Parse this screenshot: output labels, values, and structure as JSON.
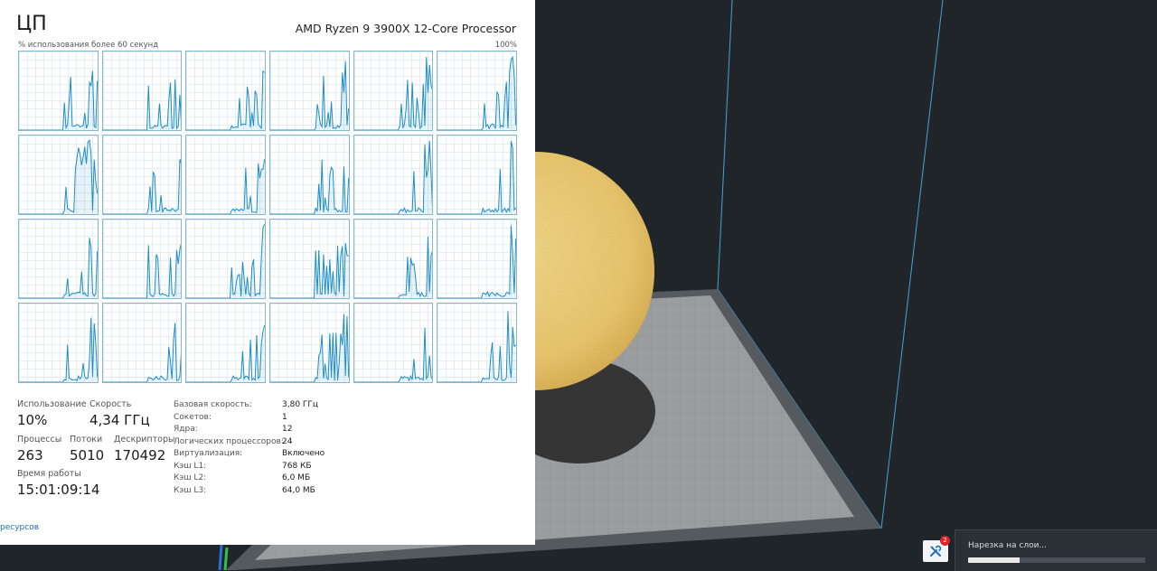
{
  "task_manager": {
    "title": "ЦП",
    "cpu_name": "AMD Ryzen 9 3900X 12-Core Processor",
    "graph_subtitle": "% использования более 60 секунд",
    "graph_max": "100%",
    "logical_processor_count": 24,
    "stats": {
      "usage_label": "Использование",
      "usage_value": "10%",
      "speed_label": "Скорость",
      "speed_value": "4,34 ГГц",
      "processes_label": "Процессы",
      "processes_value": "263",
      "threads_label": "Потоки",
      "threads_value": "5010",
      "handles_label": "Дескрипторы",
      "handles_value": "170492",
      "uptime_label": "Время работы",
      "uptime_value": "15:01:09:14"
    },
    "specs": [
      {
        "label": "Базовая скорость:",
        "value": "3,80 ГГц"
      },
      {
        "label": "Сокетов:",
        "value": "1"
      },
      {
        "label": "Ядра:",
        "value": "12"
      },
      {
        "label": "Логических процессоров:",
        "value": "24"
      },
      {
        "label": "Виртуализация:",
        "value": "Включено"
      },
      {
        "label": "Кэш L1:",
        "value": "768 КБ"
      },
      {
        "label": "Кэш L2:",
        "value": "6,0 МБ"
      },
      {
        "label": "Кэш L3:",
        "value": "64,0 МБ"
      }
    ],
    "resource_monitor_link": "ресурсов",
    "graph_color": "#1f8dc6"
  },
  "slicer": {
    "notification_count": "2",
    "slicing_label": "Нарезка на слои...",
    "slicing_progress_percent": 29,
    "tool_icon": "tools-icon"
  }
}
